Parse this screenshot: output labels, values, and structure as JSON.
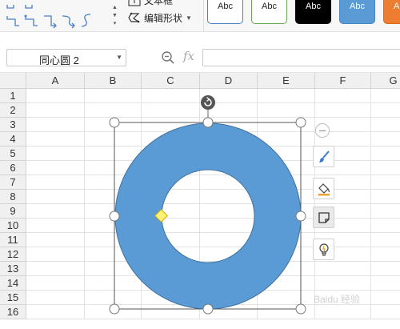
{
  "ribbon": {
    "connectors": [
      "elbow-connector-icon",
      "elbow-connector-icon",
      "elbow-arrow-connector-icon",
      "curved-arrow-connector-icon",
      "curved-connector-icon"
    ],
    "text_box_label": "文本框",
    "edit_shape_label": "编辑形状",
    "styles": [
      {
        "label": "Abc",
        "bg": "#ffffff",
        "border": "#4a7fc1",
        "color": "#222222"
      },
      {
        "label": "Abc",
        "bg": "#ffffff",
        "border": "#6aa84f",
        "color": "#222222"
      },
      {
        "label": "Abc",
        "bg": "#000000",
        "border": "#000000",
        "color": "#ffffff"
      },
      {
        "label": "Abc",
        "bg": "#5b9bd5",
        "border": "#4a86c2",
        "color": "#ffffff"
      },
      {
        "label": "Abc",
        "bg": "#ed7d31",
        "border": "#d86b21",
        "color": "#ffffff"
      }
    ]
  },
  "formula_bar": {
    "name_box_value": "同心圆 2",
    "fx_label": "fx",
    "formula_value": ""
  },
  "sheet": {
    "columns": [
      "A",
      "B",
      "C",
      "D",
      "E",
      "F",
      "G"
    ],
    "rows": [
      "1",
      "2",
      "3",
      "4",
      "5",
      "6",
      "7",
      "8",
      "9",
      "10",
      "11",
      "12",
      "13",
      "14",
      "15",
      "16"
    ]
  },
  "shape": {
    "name": "同心圆 2",
    "fill_color": "#5b9bd5",
    "outline_color": "#41719c",
    "adjust_handle_color": "#fff275"
  },
  "float_toolbar": [
    "brush-icon",
    "fill-bucket-icon",
    "shape-outline-icon",
    "idea-bulb-icon"
  ],
  "watermark": "Baidu 经验"
}
